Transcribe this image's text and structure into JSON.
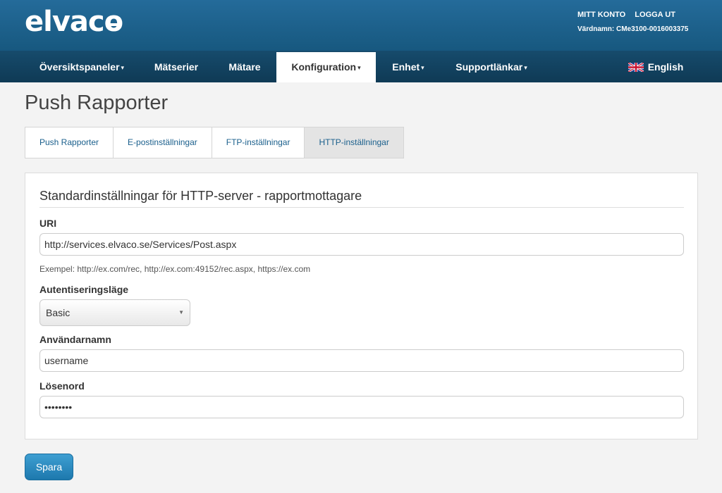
{
  "header": {
    "logo_text": "elvaco",
    "account_link": "MITT KONTO",
    "logout_link": "LOGGA UT",
    "hostname": "Värdnamn: CMe3100-0016003375"
  },
  "nav": {
    "items": [
      {
        "label": "Översiktspaneler",
        "caret": "▾"
      },
      {
        "label": "Mätserier"
      },
      {
        "label": "Mätare"
      },
      {
        "label": "Konfiguration",
        "caret": "▾",
        "active": true
      },
      {
        "label": "Enhet",
        "caret": "▾"
      },
      {
        "label": "Supportlänkar",
        "caret": "▾"
      }
    ],
    "language": "English",
    "language_icon": "uk-flag-icon"
  },
  "page": {
    "title": "Push Rapporter"
  },
  "tabs": [
    {
      "label": "Push Rapporter"
    },
    {
      "label": "E-postinställningar"
    },
    {
      "label": "FTP-inställningar"
    },
    {
      "label": "HTTP-inställningar",
      "active": true
    }
  ],
  "form": {
    "section_title": "Standardinställningar för HTTP-server - rapportmottagare",
    "uri_label": "URI",
    "uri_value": "http://services.elvaco.se/Services/Post.aspx",
    "uri_help": "Exempel: http://ex.com/rec, http://ex.com:49152/rec.aspx, https://ex.com",
    "auth_label": "Autentiseringsläge",
    "auth_value": "Basic",
    "username_label": "Användarnamn",
    "username_value": "username",
    "password_label": "Lösenord",
    "password_value": "••••••••"
  },
  "actions": {
    "save_label": "Spara"
  },
  "colors": {
    "header_blue": "#1d6594",
    "nav_dark": "#123f5c",
    "link_blue": "#1a5f8c",
    "button_blue": "#2a8bc2"
  }
}
